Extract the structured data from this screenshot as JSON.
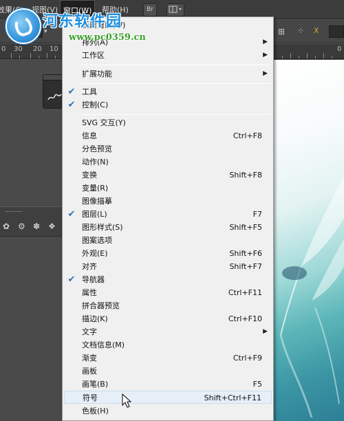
{
  "menubar": {
    "items": [
      {
        "label": "效果(C)"
      },
      {
        "label": "视图(V)"
      },
      {
        "label": "窗口(W)"
      },
      {
        "label": "帮助(H)"
      }
    ],
    "bridge_button": "Br"
  },
  "ruler": {
    "labels": [
      "0",
      "30",
      "20",
      "10",
      "0"
    ]
  },
  "watermark": {
    "title": "河东软件园",
    "url": "www.pc0359.cn"
  },
  "menu": {
    "items": [
      {
        "label": "新建窗口(W)",
        "checked": false,
        "shortcut": "",
        "submenu": false
      },
      {
        "label": "排列(A)",
        "checked": false,
        "shortcut": "",
        "submenu": true
      },
      {
        "label": "工作区",
        "checked": false,
        "shortcut": "",
        "submenu": true
      },
      {
        "label": "扩展功能",
        "checked": false,
        "shortcut": "",
        "submenu": true
      },
      {
        "label": "工具",
        "checked": true,
        "shortcut": "",
        "submenu": false
      },
      {
        "label": "控制(C)",
        "checked": true,
        "shortcut": "",
        "submenu": false
      },
      {
        "label": "SVG 交互(Y)",
        "checked": false,
        "shortcut": "",
        "submenu": false
      },
      {
        "label": "信息",
        "checked": false,
        "shortcut": "Ctrl+F8",
        "submenu": false
      },
      {
        "label": "分色预览",
        "checked": false,
        "shortcut": "",
        "submenu": false
      },
      {
        "label": "动作(N)",
        "checked": false,
        "shortcut": "",
        "submenu": false
      },
      {
        "label": "变换",
        "checked": false,
        "shortcut": "Shift+F8",
        "submenu": false
      },
      {
        "label": "变量(R)",
        "checked": false,
        "shortcut": "",
        "submenu": false
      },
      {
        "label": "图像描摹",
        "checked": false,
        "shortcut": "",
        "submenu": false
      },
      {
        "label": "图层(L)",
        "checked": true,
        "shortcut": "F7",
        "submenu": false
      },
      {
        "label": "图形样式(S)",
        "checked": false,
        "shortcut": "Shift+F5",
        "submenu": false
      },
      {
        "label": "图案选项",
        "checked": false,
        "shortcut": "",
        "submenu": false
      },
      {
        "label": "外观(E)",
        "checked": false,
        "shortcut": "Shift+F6",
        "submenu": false
      },
      {
        "label": "对齐",
        "checked": false,
        "shortcut": "Shift+F7",
        "submenu": false
      },
      {
        "label": "导航器",
        "checked": true,
        "shortcut": "",
        "submenu": false
      },
      {
        "label": "属性",
        "checked": false,
        "shortcut": "Ctrl+F11",
        "submenu": false
      },
      {
        "label": "拼合器预览",
        "checked": false,
        "shortcut": "",
        "submenu": false
      },
      {
        "label": "描边(K)",
        "checked": false,
        "shortcut": "Ctrl+F10",
        "submenu": false
      },
      {
        "label": "文字",
        "checked": false,
        "shortcut": "",
        "submenu": true
      },
      {
        "label": "文档信息(M)",
        "checked": false,
        "shortcut": "",
        "submenu": false
      },
      {
        "label": "渐变",
        "checked": false,
        "shortcut": "Ctrl+F9",
        "submenu": false
      },
      {
        "label": "画板",
        "checked": false,
        "shortcut": "",
        "submenu": false
      },
      {
        "label": "画笔(B)",
        "checked": false,
        "shortcut": "F5",
        "submenu": false
      },
      {
        "label": "符号",
        "checked": false,
        "shortcut": "Shift+Ctrl+F11",
        "submenu": false
      },
      {
        "label": "色板(H)",
        "checked": false,
        "shortcut": "",
        "submenu": false
      }
    ],
    "highlighted_item": "符号"
  },
  "colors": {
    "menu_bg": "#f0f0f0",
    "checkmark": "#2b6fb5",
    "menubar_bg": "#3c3c3c",
    "watermark_title": "#1e8fe0",
    "watermark_url": "#3aa02b"
  }
}
